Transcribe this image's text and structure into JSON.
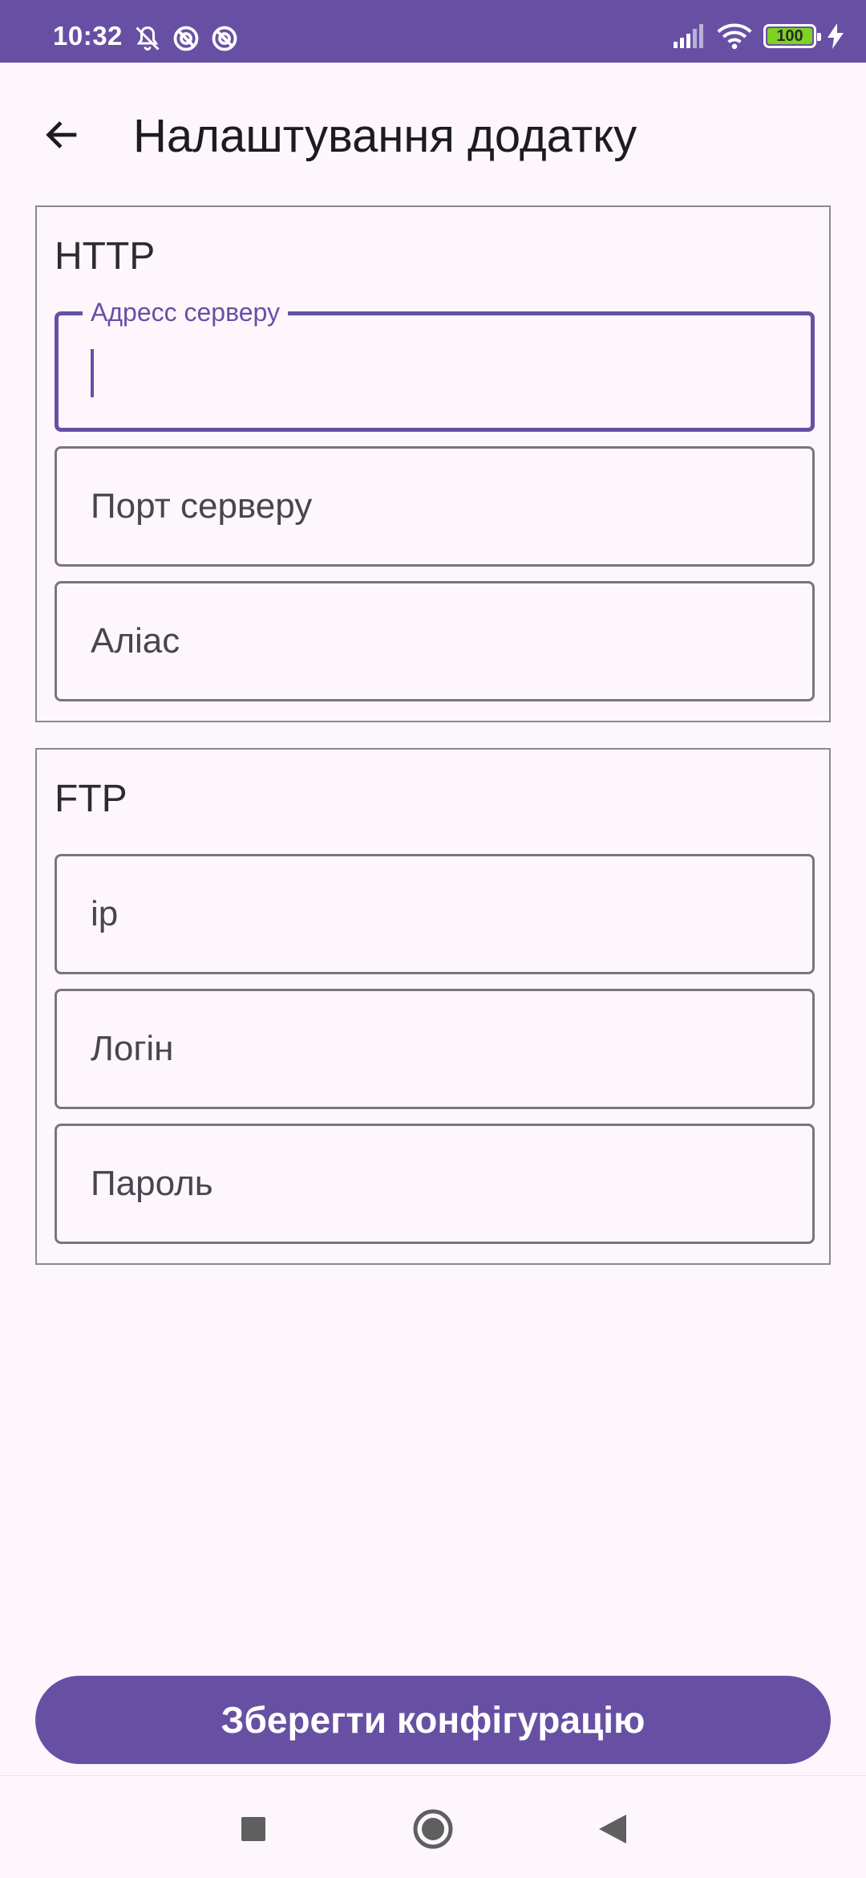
{
  "status_bar": {
    "time": "10:32",
    "battery_level": "100",
    "battery_color": "#7ed321",
    "icons_left": [
      "notifications-muted-icon",
      "blocked-icon",
      "blocked-icon"
    ],
    "icons_right": [
      "cellular-signal-icon",
      "wifi-icon",
      "battery-icon",
      "charging-icon"
    ]
  },
  "app_bar": {
    "title": "Налаштування додатку",
    "back_icon": "arrow-left-icon"
  },
  "http_section": {
    "title": "HTTP",
    "fields": [
      {
        "label": "Адресс серверу",
        "value": "",
        "focused": true
      },
      {
        "label": "Порт серверу",
        "value": ""
      },
      {
        "label": "Аліас",
        "value": ""
      }
    ]
  },
  "ftp_section": {
    "title": "FTP",
    "fields": [
      {
        "label": "ip",
        "value": ""
      },
      {
        "label": "Логін",
        "value": ""
      },
      {
        "label": "Пароль",
        "value": ""
      }
    ]
  },
  "save_button": {
    "label": "Зберегти конфігурацію"
  },
  "colors": {
    "primary": "#6750a4",
    "background": "#fdf7fd",
    "outline": "#79747e"
  },
  "nav_bar": {
    "buttons": [
      "recents-square-icon",
      "home-circle-icon",
      "back-triangle-icon"
    ]
  }
}
